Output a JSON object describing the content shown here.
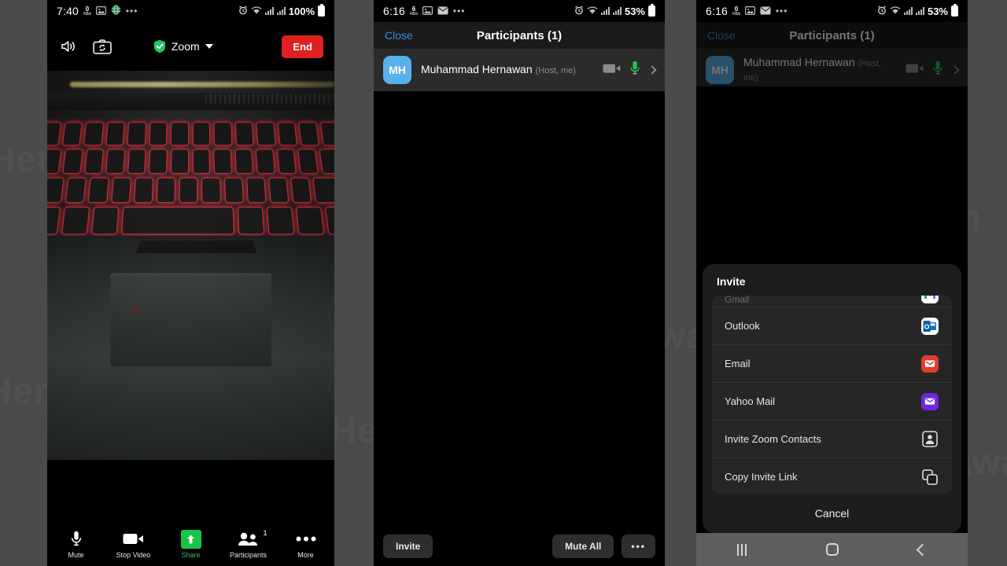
{
  "meta": {
    "backdrop_color": "#4a4a4a",
    "watermark_text": "Hernawan"
  },
  "panel1": {
    "status_bar": {
      "time": "7:40",
      "rate_value": "0",
      "rate_unit": "KB/s",
      "icons": [
        "image-icon",
        "globe-icon",
        "overflow-icon"
      ],
      "right_icons": [
        "alarm-icon",
        "wifi-icon",
        "signal-icon",
        "signal-icon"
      ],
      "battery_percent": "100%"
    },
    "topbar": {
      "speaker_icon": "speaker-icon",
      "flip_camera_icon": "flip-camera-icon",
      "app_label": "Zoom",
      "shield_icon": "shield-check-icon",
      "chevron_icon": "chevron-down-icon",
      "end_label": "End"
    },
    "video": {
      "description": "red backlit gaming laptop keyboard"
    },
    "toolbar": [
      {
        "label": "Mute",
        "icon": "microphone-icon",
        "accent": false,
        "badge": ""
      },
      {
        "label": "Stop Video",
        "icon": "video-camera-icon",
        "accent": false,
        "badge": ""
      },
      {
        "label": "Share",
        "icon": "share-arrow-up-icon",
        "accent": true,
        "badge": ""
      },
      {
        "label": "Participants",
        "icon": "participants-icon",
        "accent": false,
        "badge": "1"
      },
      {
        "label": "More",
        "icon": "overflow-icon",
        "accent": false,
        "badge": ""
      }
    ]
  },
  "panel2": {
    "status_bar": {
      "time": "6:16",
      "rate_value": "6",
      "rate_unit": "KB/s",
      "icons": [
        "image-icon",
        "mail-icon",
        "overflow-icon"
      ],
      "right_icons": [
        "alarm-icon",
        "wifi-icon",
        "signal-icon",
        "signal-icon"
      ],
      "battery_percent": "53%"
    },
    "header": {
      "close_label": "Close",
      "title": "Participants (1)"
    },
    "participants": [
      {
        "initials": "MH",
        "name": "Muhammad Hernawan",
        "role": "(Host, me)",
        "video_icon": "video-camera-off-icon",
        "mic_icon": "microphone-on-icon",
        "chevron_icon": "chevron-right-icon"
      }
    ],
    "footer": {
      "invite_label": "Invite",
      "mute_all_label": "Mute All",
      "more_label": "•••"
    }
  },
  "panel3": {
    "status_bar": {
      "time": "6:16",
      "rate_value": "0",
      "rate_unit": "KB/s",
      "icons": [
        "image-icon",
        "mail-icon",
        "overflow-icon"
      ],
      "right_icons": [
        "alarm-icon",
        "wifi-icon",
        "signal-icon",
        "signal-icon"
      ],
      "battery_percent": "53%"
    },
    "header": {
      "close_label": "Close",
      "title": "Participants (1)"
    },
    "participants": [
      {
        "initials": "MH",
        "name": "Muhammad Hernawan",
        "role": "(Host, me)",
        "video_icon": "video-camera-off-icon",
        "mic_icon": "microphone-on-icon",
        "chevron_icon": "chevron-right-icon"
      }
    ],
    "invite_sheet": {
      "title": "Invite",
      "options": [
        {
          "label": "Gmail",
          "icon": "gmail-icon",
          "icon_bg": "#ffffff",
          "partial": true
        },
        {
          "label": "Outlook",
          "icon": "outlook-icon",
          "icon_bg": "#ffffff",
          "partial": false
        },
        {
          "label": "Email",
          "icon": "email-icon",
          "icon_bg": "#e33b2e",
          "partial": false
        },
        {
          "label": "Yahoo Mail",
          "icon": "yahoo-mail-icon",
          "icon_bg": "#6d28e0",
          "partial": false
        },
        {
          "label": "Invite Zoom Contacts",
          "icon": "contact-card-icon",
          "icon_bg": "none",
          "partial": false
        },
        {
          "label": "Copy Invite Link",
          "icon": "copy-icon",
          "icon_bg": "none",
          "partial": false
        }
      ],
      "cancel_label": "Cancel"
    },
    "navbar": {
      "recents_icon": "recents-icon",
      "home_icon": "home-icon",
      "back_icon": "back-icon"
    }
  }
}
